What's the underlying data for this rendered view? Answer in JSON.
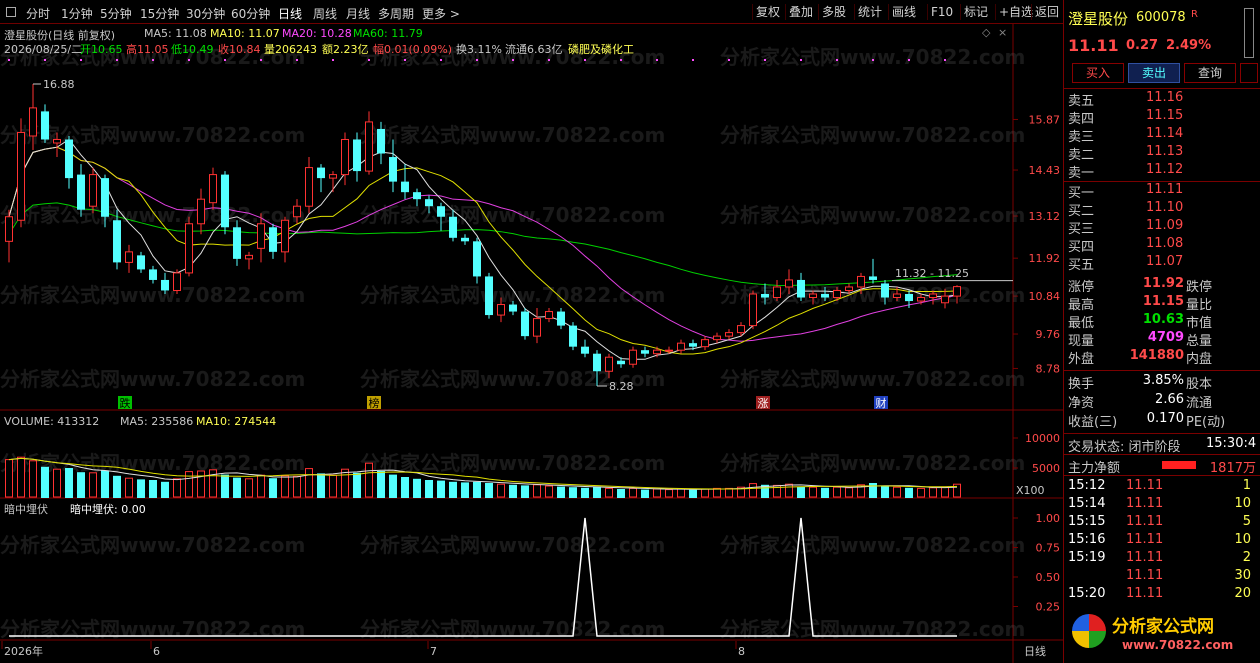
{
  "toolbar": {
    "periods": [
      "分时",
      "1分钟",
      "5分钟",
      "15分钟",
      "30分钟",
      "60分钟",
      "日线",
      "周线",
      "月线",
      "多周期",
      "更多 >"
    ],
    "tools": [
      "复权",
      "叠加",
      "多股",
      "统计",
      "画线",
      "F10",
      "标记",
      "+自选",
      "返回"
    ]
  },
  "header": {
    "title": "澄星股份(日线 前复权)",
    "ma5": "MA5: 11.08",
    "ma10": "MA10: 11.07",
    "ma20": "MA20: 10.28",
    "ma60": "MA60: 11.79",
    "date": "2026/08/25/二",
    "open": "开10.65",
    "high": "高11.05",
    "low": "低10.49",
    "close": "收10.84",
    "volume": "量206243",
    "amount": "额2.23亿",
    "change": "幅0.01(0.09%)",
    "turnover": "换3.11%",
    "float": "流通6.63亿",
    "sector": "磷肥及磷化工"
  },
  "price_axis": [
    "15.87",
    "14.43",
    "13.12",
    "11.92",
    "10.84",
    "9.76",
    "8.78"
  ],
  "annotations": {
    "high_mark": "16.88",
    "low_mark": "8.28",
    "range_label": "11.32 - 11.25",
    "events": [
      "跌",
      "榜",
      "涨",
      "财"
    ]
  },
  "volume_panel": {
    "label": "VOLUME: 413312",
    "ma5": "MA5: 235586",
    "ma10": "MA10: 274544",
    "axis": [
      "10000",
      "5000"
    ],
    "unit": "X100"
  },
  "indicator_panel": {
    "label": "暗中埋伏",
    "value": "暗中埋伏: 0.00",
    "axis": [
      "1.00",
      "0.75",
      "0.50",
      "0.25"
    ]
  },
  "time_axis": {
    "labels": [
      "2026年",
      "6",
      "7",
      "8"
    ],
    "period": "日线"
  },
  "watermark": "分析家公式网www.70822.com",
  "quote": {
    "name": "澄星股份",
    "code": "600078",
    "flag": "R",
    "price": "11.11",
    "change": "0.27",
    "pct": "2.49%",
    "buttons": [
      "买入",
      "卖出",
      "查询"
    ],
    "asks": [
      {
        "label": "卖五",
        "price": "11.16"
      },
      {
        "label": "卖四",
        "price": "11.15"
      },
      {
        "label": "卖三",
        "price": "11.14"
      },
      {
        "label": "卖二",
        "price": "11.13"
      },
      {
        "label": "卖一",
        "price": "11.12"
      }
    ],
    "bids": [
      {
        "label": "买一",
        "price": "11.11"
      },
      {
        "label": "买二",
        "price": "11.10"
      },
      {
        "label": "买三",
        "price": "11.09"
      },
      {
        "label": "买四",
        "price": "11.08"
      },
      {
        "label": "买五",
        "price": "11.07"
      }
    ],
    "stats": [
      {
        "l1": "涨停",
        "v1": "11.92",
        "l2": "跌停"
      },
      {
        "l1": "最高",
        "v1": "11.15",
        "l2": "量比"
      },
      {
        "l1": "最低",
        "v1": "10.63",
        "l2": "市值"
      },
      {
        "l1": "现量",
        "v1": "4709",
        "l2": "总量"
      },
      {
        "l1": "外盘",
        "v1": "141880",
        "l2": "内盘"
      }
    ],
    "stats2": [
      {
        "l1": "换手",
        "v1": "3.85%",
        "l2": "股本"
      },
      {
        "l1": "净资",
        "v1": "2.66",
        "l2": "流通"
      },
      {
        "l1": "收益(三)",
        "v1": "0.170",
        "l2": "PE(动)"
      }
    ],
    "status_label": "交易状态: 闭市阶段",
    "status_time": "15:30:4",
    "main_flow_label": "主力净额",
    "main_flow_value": "1817万",
    "ticks": [
      {
        "time": "15:12",
        "price": "11.11",
        "vol": "1"
      },
      {
        "time": "15:14",
        "price": "11.11",
        "vol": "10"
      },
      {
        "time": "15:15",
        "price": "11.11",
        "vol": "5"
      },
      {
        "time": "15:16",
        "price": "11.11",
        "vol": "10"
      },
      {
        "time": "15:19",
        "price": "11.11",
        "vol": "2"
      },
      {
        "time": "",
        "price": "11.11",
        "vol": "30"
      },
      {
        "time": "15:20",
        "price": "11.11",
        "vol": "20"
      }
    ],
    "logo_text": "分析家公式网",
    "logo_url": "www.70822.com"
  },
  "chart_data": {
    "type": "candlestick",
    "candles": [
      [
        12.4,
        13.3,
        11.8,
        13.1
      ],
      [
        13.0,
        15.9,
        12.8,
        15.5
      ],
      [
        15.4,
        16.88,
        15.0,
        16.2
      ],
      [
        16.1,
        16.3,
        15.2,
        15.3
      ],
      [
        15.2,
        15.5,
        14.8,
        15.3
      ],
      [
        15.3,
        15.4,
        13.9,
        14.2
      ],
      [
        14.3,
        14.6,
        13.1,
        13.3
      ],
      [
        13.4,
        14.5,
        13.2,
        14.3
      ],
      [
        14.2,
        14.3,
        12.8,
        13.1
      ],
      [
        13.0,
        13.3,
        11.6,
        11.8
      ],
      [
        11.8,
        12.3,
        11.5,
        12.1
      ],
      [
        12.0,
        12.1,
        11.5,
        11.6
      ],
      [
        11.6,
        11.7,
        11.2,
        11.3
      ],
      [
        11.3,
        11.5,
        10.9,
        11.0
      ],
      [
        11.0,
        11.6,
        10.9,
        11.5
      ],
      [
        11.5,
        13.1,
        11.4,
        12.9
      ],
      [
        12.9,
        13.9,
        12.6,
        13.6
      ],
      [
        13.5,
        14.5,
        13.3,
        14.3
      ],
      [
        14.3,
        14.4,
        12.6,
        12.8
      ],
      [
        12.8,
        13.0,
        11.7,
        11.9
      ],
      [
        11.9,
        12.1,
        11.6,
        12.0
      ],
      [
        12.2,
        13.2,
        11.8,
        12.9
      ],
      [
        12.8,
        12.9,
        11.9,
        12.1
      ],
      [
        12.1,
        13.1,
        11.8,
        13.0
      ],
      [
        13.1,
        13.6,
        12.9,
        13.4
      ],
      [
        13.4,
        14.8,
        13.2,
        14.5
      ],
      [
        14.5,
        14.6,
        13.8,
        14.2
      ],
      [
        14.2,
        14.4,
        13.8,
        14.3
      ],
      [
        14.3,
        15.5,
        14.0,
        15.3
      ],
      [
        15.3,
        15.5,
        14.1,
        14.4
      ],
      [
        14.4,
        16.1,
        14.3,
        15.8
      ],
      [
        15.6,
        15.8,
        14.6,
        14.9
      ],
      [
        14.8,
        15.3,
        13.8,
        14.1
      ],
      [
        14.1,
        14.6,
        13.6,
        13.8
      ],
      [
        13.8,
        13.9,
        13.4,
        13.6
      ],
      [
        13.6,
        13.7,
        13.2,
        13.4
      ],
      [
        13.4,
        13.5,
        12.7,
        13.1
      ],
      [
        13.1,
        13.3,
        12.4,
        12.5
      ],
      [
        12.5,
        12.6,
        12.3,
        12.4
      ],
      [
        12.4,
        12.5,
        11.2,
        11.4
      ],
      [
        11.4,
        11.5,
        10.2,
        10.3
      ],
      [
        10.3,
        10.8,
        10.1,
        10.6
      ],
      [
        10.6,
        10.7,
        10.3,
        10.4
      ],
      [
        10.4,
        10.5,
        9.6,
        9.7
      ],
      [
        9.7,
        10.5,
        9.5,
        10.2
      ],
      [
        10.2,
        10.5,
        10.1,
        10.4
      ],
      [
        10.4,
        10.5,
        9.9,
        10.0
      ],
      [
        10.0,
        10.1,
        9.3,
        9.4
      ],
      [
        9.4,
        9.6,
        9.1,
        9.2
      ],
      [
        9.2,
        9.3,
        8.28,
        8.7
      ],
      [
        8.7,
        9.2,
        8.5,
        9.1
      ],
      [
        9.0,
        9.1,
        8.8,
        8.9
      ],
      [
        8.9,
        9.4,
        8.8,
        9.3
      ],
      [
        9.3,
        9.4,
        9.1,
        9.2
      ],
      [
        9.2,
        9.4,
        9.1,
        9.3
      ],
      [
        9.3,
        9.4,
        9.2,
        9.3
      ],
      [
        9.3,
        9.6,
        9.2,
        9.5
      ],
      [
        9.5,
        9.6,
        9.3,
        9.4
      ],
      [
        9.4,
        9.7,
        9.3,
        9.6
      ],
      [
        9.6,
        9.8,
        9.5,
        9.7
      ],
      [
        9.7,
        9.9,
        9.6,
        9.8
      ],
      [
        9.8,
        10.1,
        9.7,
        10.0
      ],
      [
        10.0,
        11.0,
        9.9,
        10.9
      ],
      [
        10.9,
        11.2,
        10.6,
        10.8
      ],
      [
        10.8,
        11.3,
        10.7,
        11.1
      ],
      [
        11.1,
        11.6,
        10.9,
        11.3
      ],
      [
        11.3,
        11.5,
        10.7,
        10.8
      ],
      [
        10.8,
        11.0,
        10.6,
        10.9
      ],
      [
        10.9,
        11.1,
        10.7,
        10.8
      ],
      [
        10.8,
        11.1,
        10.7,
        11.0
      ],
      [
        11.0,
        11.2,
        10.9,
        11.1
      ],
      [
        11.1,
        11.5,
        10.9,
        11.4
      ],
      [
        11.4,
        11.9,
        11.2,
        11.3
      ],
      [
        11.2,
        11.3,
        10.6,
        10.8
      ],
      [
        10.8,
        11.1,
        10.7,
        10.9
      ],
      [
        10.9,
        11.0,
        10.5,
        10.7
      ],
      [
        10.7,
        10.9,
        10.6,
        10.8
      ],
      [
        10.8,
        11.0,
        10.6,
        10.9
      ],
      [
        10.65,
        11.05,
        10.49,
        10.84
      ],
      [
        10.84,
        11.15,
        10.63,
        11.11
      ]
    ],
    "volumes": [
      6400,
      6800,
      6200,
      5200,
      4800,
      5000,
      4300,
      4200,
      4600,
      3700,
      3300,
      3100,
      3000,
      2700,
      3200,
      4400,
      4500,
      4700,
      3900,
      3400,
      3200,
      3800,
      3300,
      3700,
      3600,
      4900,
      4100,
      3800,
      4800,
      4200,
      5800,
      4500,
      3900,
      3500,
      3200,
      3000,
      2900,
      2700,
      2600,
      2700,
      2500,
      2300,
      2200,
      2100,
      2200,
      2000,
      1900,
      1800,
      1700,
      1900,
      1600,
      1500,
      1600,
      1400,
      1500,
      1400,
      1500,
      1400,
      1500,
      1600,
      1600,
      1800,
      2400,
      2200,
      2100,
      2300,
      1900,
      1800,
      1700,
      1800,
      1700,
      2200,
      2500,
      2000,
      1800,
      1700,
      1600,
      1700,
      1800,
      2300
    ],
    "indicator_spikes": [
      48,
      66
    ],
    "ylim": [
      8.28,
      16.88
    ]
  }
}
